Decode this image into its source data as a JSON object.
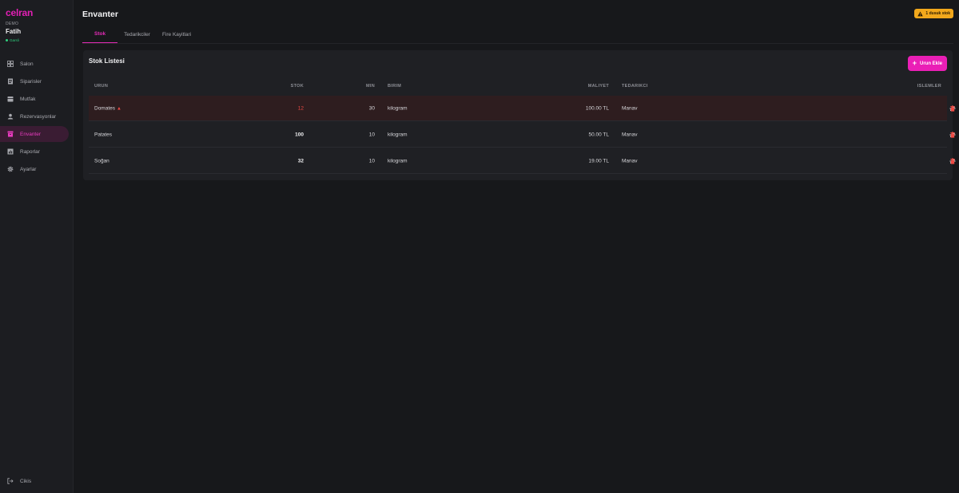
{
  "app": {
    "logo": "celran",
    "workspace": "DEMO",
    "user": "Fatih",
    "status": "Garsli"
  },
  "nav": [
    {
      "label": "Salon",
      "icon": "grid-icon"
    },
    {
      "label": "Siparisler",
      "icon": "receipt-icon"
    },
    {
      "label": "Mutfak",
      "icon": "kitchen-icon"
    },
    {
      "label": "Rezervasyonlar",
      "icon": "reservation-icon"
    },
    {
      "label": "Envanter",
      "icon": "inventory-icon",
      "active": true
    },
    {
      "label": "Raporlar",
      "icon": "chart-icon"
    },
    {
      "label": "Ayarlar",
      "icon": "gear-icon"
    }
  ],
  "logout": {
    "label": "Cikis",
    "icon": "logout-icon"
  },
  "header": {
    "title": "Envanter",
    "badge": "1 dusuk stok"
  },
  "tabs": [
    {
      "label": "Stok",
      "active": true
    },
    {
      "label": "Tedarikciler"
    },
    {
      "label": "Fire Kayitlari"
    }
  ],
  "card": {
    "title": "Stok Listesi",
    "add_button": "Urun Ekle",
    "columns": {
      "name": "URUN",
      "stock": "STOK",
      "min": "MIN",
      "unit": "BIRIM",
      "cost": "MALIYET",
      "supplier": "TEDARIKCI",
      "actions": "ISLEMLER"
    },
    "rows": [
      {
        "name": "Domates",
        "stock": "12",
        "min": "30",
        "unit": "kilogram",
        "cost": "100.00 TL",
        "supplier": "Manav",
        "low": true
      },
      {
        "name": "Patates",
        "stock": "100",
        "min": "10",
        "unit": "kilogram",
        "cost": "50.00 TL",
        "supplier": "Manav",
        "low": false
      },
      {
        "name": "Soğan",
        "stock": "32",
        "min": "10",
        "unit": "kilogram",
        "cost": "19.00 TL",
        "supplier": "Manav",
        "low": false
      }
    ]
  },
  "colors": {
    "accent": "#ea1fb6",
    "warning": "#f2a81c",
    "danger": "#ef4a44",
    "success": "#2fd07e"
  }
}
